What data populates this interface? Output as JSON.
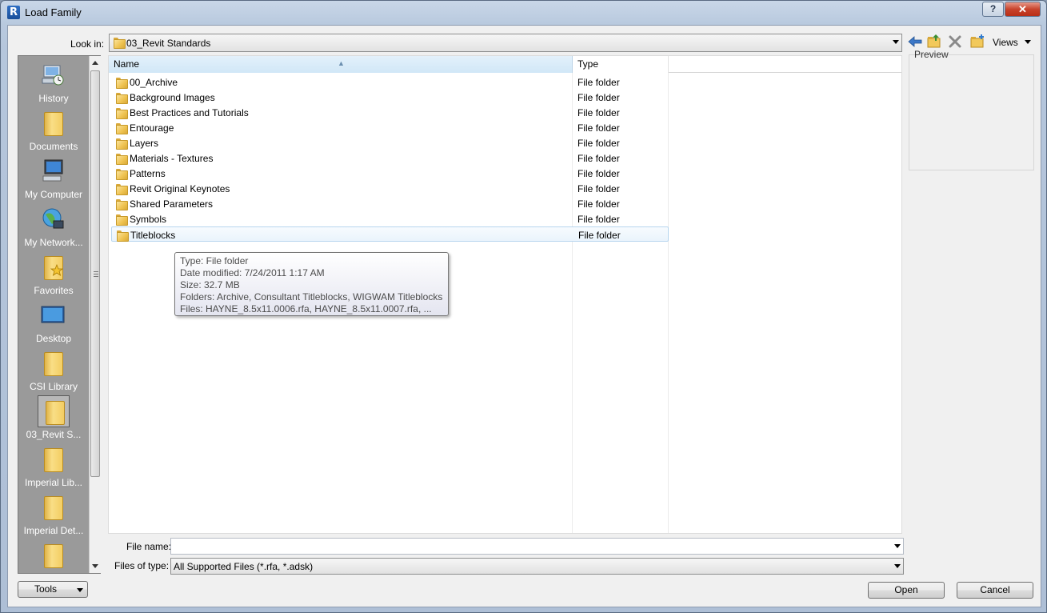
{
  "window": {
    "title": "Load Family",
    "app_icon_letter": "R",
    "help_label": "?",
    "close_label": "✕"
  },
  "lookin": {
    "label": "Look in:",
    "value": "03_Revit Standards"
  },
  "toolbar": {
    "views_label": "Views"
  },
  "places": [
    {
      "label": "History",
      "icon": "history-icon"
    },
    {
      "label": "Documents",
      "icon": "documents-folder-icon"
    },
    {
      "label": "My Computer",
      "icon": "computer-icon"
    },
    {
      "label": "My Network...",
      "icon": "network-icon"
    },
    {
      "label": "Favorites",
      "icon": "favorites-folder-icon"
    },
    {
      "label": "Desktop",
      "icon": "desktop-icon"
    },
    {
      "label": "CSI Library",
      "icon": "folder-icon"
    },
    {
      "label": "03_Revit S...",
      "icon": "folder-icon"
    },
    {
      "label": "Imperial Lib...",
      "icon": "folder-icon"
    },
    {
      "label": "Imperial Det...",
      "icon": "folder-icon"
    },
    {
      "label": "",
      "icon": "folder-icon"
    }
  ],
  "filelist": {
    "columns": [
      "Name",
      "Type"
    ],
    "rows": [
      {
        "name": "00_Archive",
        "type": "File folder"
      },
      {
        "name": "Background Images",
        "type": "File folder"
      },
      {
        "name": "Best Practices and Tutorials",
        "type": "File folder"
      },
      {
        "name": "Entourage",
        "type": "File folder"
      },
      {
        "name": "Layers",
        "type": "File folder"
      },
      {
        "name": "Materials - Textures",
        "type": "File folder"
      },
      {
        "name": "Patterns",
        "type": "File folder"
      },
      {
        "name": "Revit Original Keynotes",
        "type": "File folder"
      },
      {
        "name": "Shared Parameters",
        "type": "File folder"
      },
      {
        "name": "Symbols",
        "type": "File folder"
      },
      {
        "name": "Titleblocks",
        "type": "File folder"
      }
    ]
  },
  "tooltip": {
    "lines": [
      "Type: File folder",
      "Date modified: 7/24/2011 1:17 AM",
      "Size: 32.7 MB",
      "Folders: Archive, Consultant Titleblocks, WIGWAM Titleblocks",
      "Files: HAYNE_8.5x11.0006.rfa, HAYNE_8.5x11.0007.rfa, ..."
    ]
  },
  "preview": {
    "label": "Preview"
  },
  "filename": {
    "label": "File name:",
    "value": ""
  },
  "filetype": {
    "label": "Files of type:",
    "value": "All Supported Files  (*.rfa, *.adsk)"
  },
  "buttons": {
    "tools": "Tools",
    "open": "Open",
    "cancel": "Cancel"
  }
}
